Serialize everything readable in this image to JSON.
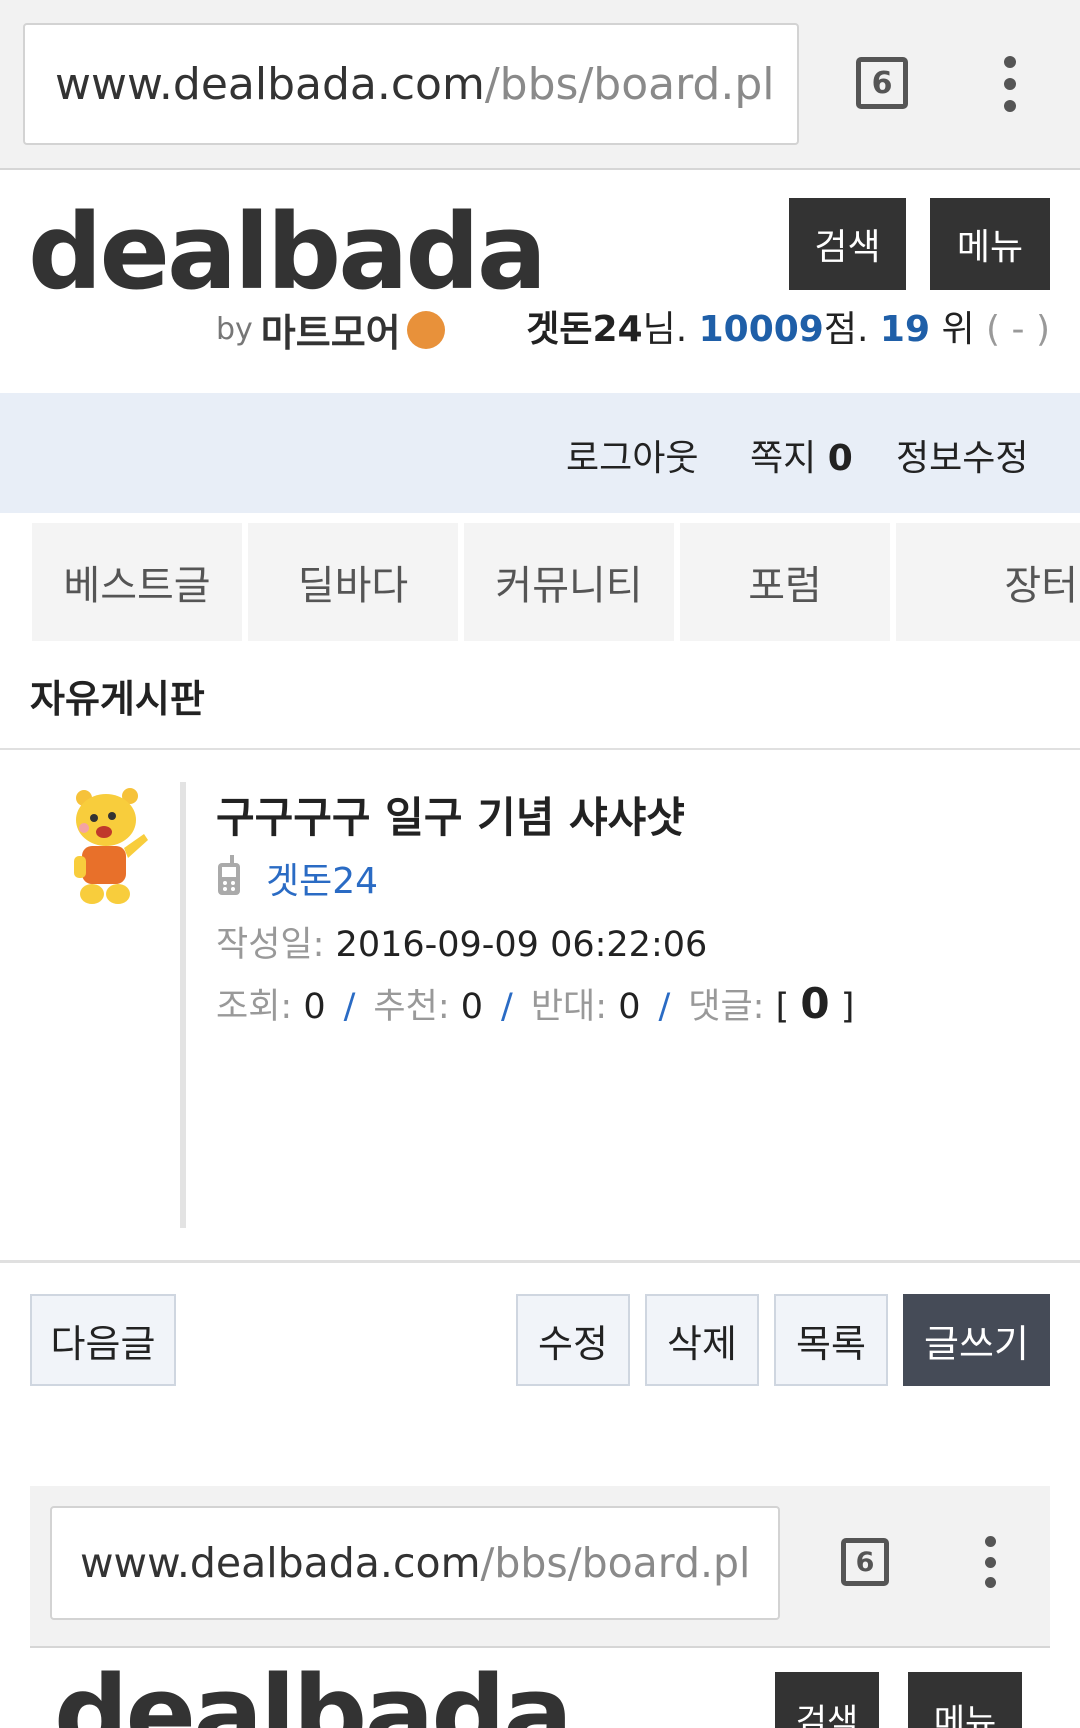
{
  "browser": {
    "url_host": "www.dealbada.com",
    "url_path": "/bbs/board.pl",
    "tab_count": "6"
  },
  "header": {
    "logo_word": "dealbada",
    "logo_by": "by",
    "logo_sub": "마트모어",
    "search_label": "검색",
    "menu_label": "메뉴",
    "user": {
      "name": "겟돈24",
      "suffix_nim": "님.",
      "points": "10009",
      "points_suffix": "점.",
      "rank": "19",
      "rank_suffix": "위",
      "rank_change": "( - )"
    }
  },
  "loginbar": {
    "logout": "로그아웃",
    "message_label": "쪽지",
    "message_count": "0",
    "edit_info": "정보수정"
  },
  "nav": {
    "items": [
      "베스트글",
      "딜바다",
      "커뮤니티",
      "포럼",
      "장터"
    ]
  },
  "board": {
    "title": "자유게시판"
  },
  "post": {
    "title": "구구구구 일구 기념 샤샤샷",
    "author": "겟돈24",
    "date_label": "작성일:",
    "date": "2016-09-09 06:22:06",
    "views_label": "조회:",
    "views": "0",
    "likes_label": "추천:",
    "likes": "0",
    "dislikes_label": "반대:",
    "dislikes": "0",
    "comments_label": "댓글:",
    "comments": "0"
  },
  "actions": {
    "next": "다음글",
    "edit": "수정",
    "delete": "삭제",
    "list": "목록",
    "write": "글쓰기"
  },
  "colors": {
    "accent_blue": "#1f5fa8",
    "loginbar_bg": "#e8eef7",
    "dark_button": "#333333"
  }
}
